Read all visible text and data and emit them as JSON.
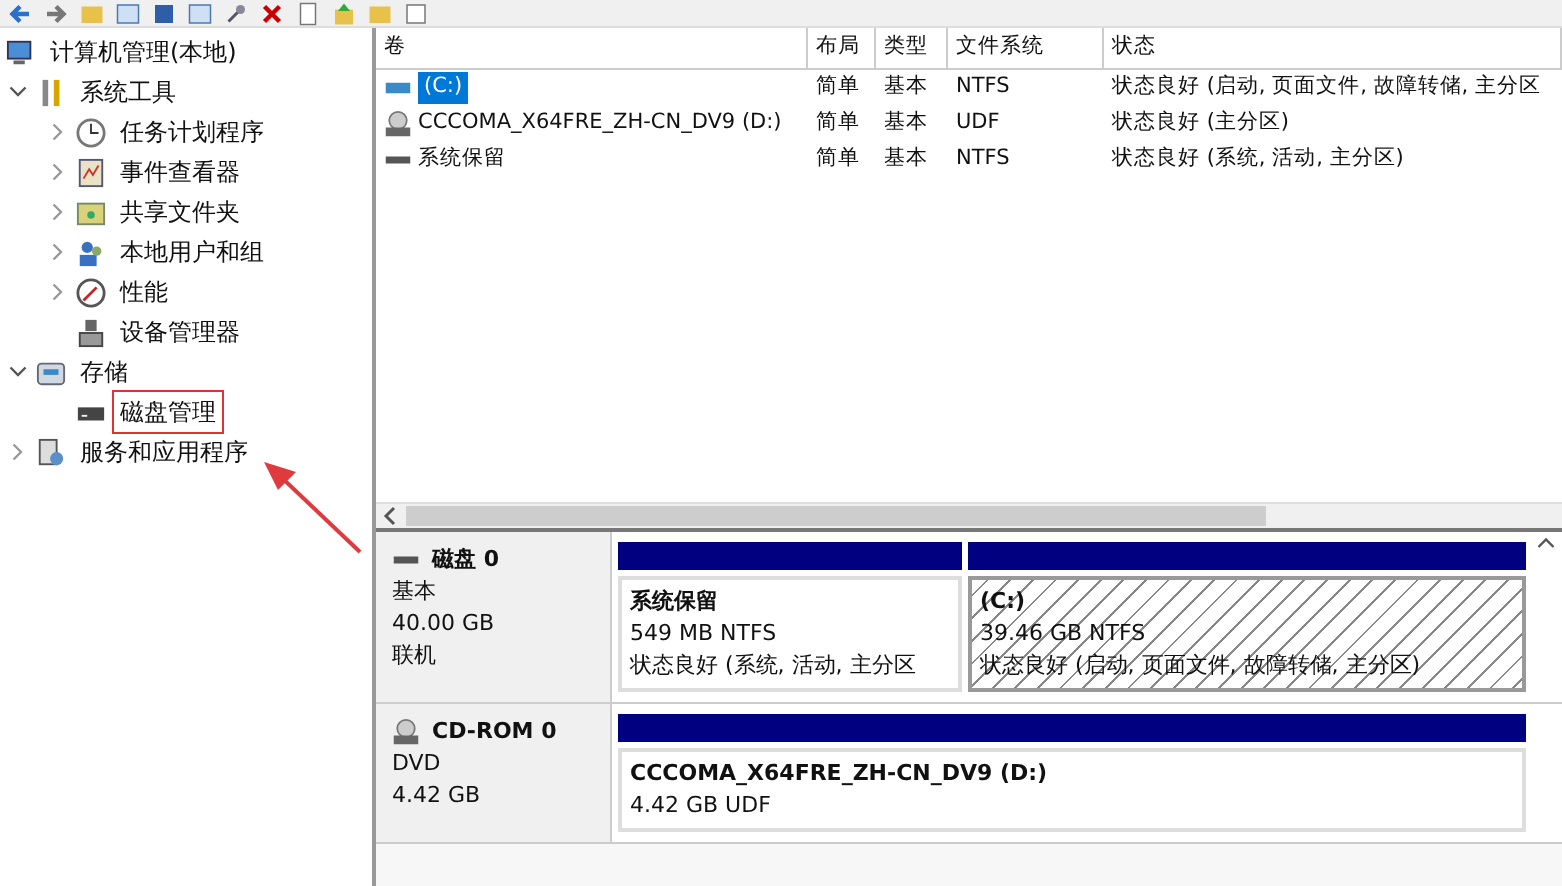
{
  "tree": [
    {
      "label": "计算机管理(本地)",
      "kind": "computer",
      "highlighted": false,
      "children": [
        {
          "label": "系统工具",
          "kind": "tools",
          "expanded": true,
          "highlighted": false,
          "children": [
            {
              "label": "任务计划程序",
              "kind": "clock",
              "expanded": false,
              "highlighted": false
            },
            {
              "label": "事件查看器",
              "kind": "log",
              "expanded": false,
              "highlighted": false
            },
            {
              "label": "共享文件夹",
              "kind": "share",
              "expanded": false,
              "highlighted": false
            },
            {
              "label": "本地用户和组",
              "kind": "users",
              "expanded": false,
              "highlighted": false
            },
            {
              "label": "性能",
              "kind": "gauge",
              "expanded": false,
              "highlighted": false
            },
            {
              "label": "设备管理器",
              "kind": "device",
              "highlighted": false
            }
          ]
        },
        {
          "label": "存储",
          "kind": "storage",
          "expanded": true,
          "highlighted": false,
          "children": [
            {
              "label": "磁盘管理",
              "kind": "disk",
              "highlighted": true
            }
          ]
        },
        {
          "label": "服务和应用程序",
          "kind": "services",
          "expanded": false,
          "highlighted": false
        }
      ]
    }
  ],
  "volumes": {
    "columns": [
      "卷",
      "布局",
      "类型",
      "文件系统",
      "状态"
    ],
    "rows": [
      {
        "kind": "disk",
        "selected": true,
        "cells": [
          "(C:)",
          "简单",
          "基本",
          "NTFS",
          "状态良好 (启动, 页面文件, 故障转储, 主分区"
        ]
      },
      {
        "kind": "cd",
        "selected": false,
        "cells": [
          "CCCOMA_X64FRE_ZH-CN_DV9 (D:)",
          "简单",
          "基本",
          "UDF",
          "状态良好 (主分区)"
        ]
      },
      {
        "kind": "disk",
        "selected": false,
        "cells": [
          "系统保留",
          "简单",
          "基本",
          "NTFS",
          "状态良好 (系统, 活动, 主分区)"
        ]
      }
    ]
  },
  "disks": [
    {
      "kind": "disk",
      "name": "磁盘 0",
      "info": [
        "基本",
        "40.00 GB",
        "联机"
      ],
      "partitions": [
        {
          "name": "系统保留",
          "size": "549 MB NTFS",
          "status": "状态良好 (系统, 活动, 主分区",
          "selected": false
        },
        {
          "name": "(C:)",
          "size": "39.46 GB NTFS",
          "status": "状态良好 (启动, 页面文件, 故障转储, 主分区)",
          "selected": true
        }
      ]
    },
    {
      "kind": "cd",
      "name": "CD-ROM 0",
      "info": [
        "DVD",
        "4.42 GB"
      ],
      "partitions": [
        {
          "name": "CCCOMA_X64FRE_ZH-CN_DV9  (D:)",
          "size": "4.42 GB UDF",
          "selected": false
        }
      ]
    }
  ]
}
